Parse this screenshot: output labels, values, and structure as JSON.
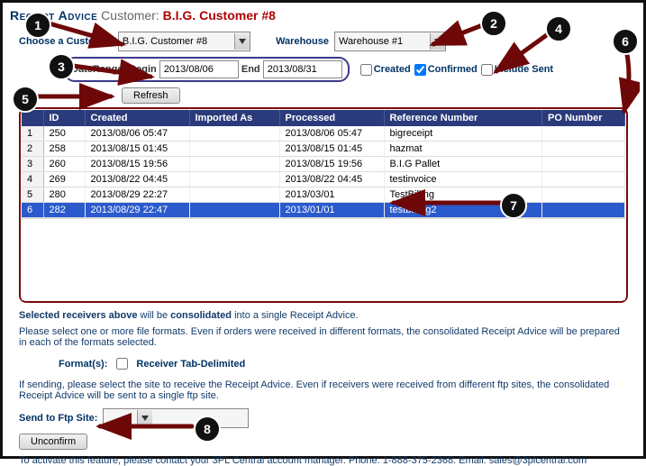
{
  "title": {
    "lead": "Receipt Advice",
    "custLabel": "Customer:",
    "name": "B.I.G. Customer #8"
  },
  "filters": {
    "chooseLabel": "Choose a Customer",
    "customer": "B.I.G. Customer #8",
    "warehouseLabel": "Warehouse",
    "warehouse": "Warehouse #1",
    "dateRangeLabel": "DateRange:",
    "beginLabel": "Begin",
    "begin": "2013/08/06",
    "endLabel": "End",
    "end": "2013/08/31",
    "createdLabel": "Created",
    "createdChecked": false,
    "confirmedLabel": "Confirmed",
    "confirmedChecked": true,
    "includeSentLabel": "Include Sent",
    "includeSentChecked": false,
    "refresh": "Refresh"
  },
  "columns": [
    "",
    "ID",
    "Created",
    "Imported As",
    "Processed",
    "Reference Number",
    "PO Number"
  ],
  "rows": [
    {
      "n": "1",
      "id": "250",
      "created": "2013/08/06 05:47",
      "imported": "",
      "processed": "2013/08/06 05:47",
      "ref": "bigreceipt",
      "po": ""
    },
    {
      "n": "2",
      "id": "258",
      "created": "2013/08/15 01:45",
      "imported": "",
      "processed": "2013/08/15 01:45",
      "ref": "hazmat",
      "po": ""
    },
    {
      "n": "3",
      "id": "260",
      "created": "2013/08/15 19:56",
      "imported": "",
      "processed": "2013/08/15 19:56",
      "ref": "B.I.G Pallet",
      "po": ""
    },
    {
      "n": "4",
      "id": "269",
      "created": "2013/08/22 04:45",
      "imported": "",
      "processed": "2013/08/22 04:45",
      "ref": "testinvoice",
      "po": ""
    },
    {
      "n": "5",
      "id": "280",
      "created": "2013/08/29 22:27",
      "imported": "",
      "processed": "2013/03/01",
      "ref": "TestBilling",
      "po": ""
    },
    {
      "n": "6",
      "id": "282",
      "created": "2013/08/29 22:47",
      "imported": "",
      "processed": "2013/01/01",
      "ref": "testbilling2",
      "po": "",
      "selected": true
    }
  ],
  "info": {
    "line1a": "Selected receivers above",
    "line1b": " will be ",
    "line1c": "consolidated",
    "line1d": " into a single Receipt Advice.",
    "line2": "Please select one or more file formats. Even if orders were received in different formats, the consolidated Receipt Advice will be prepared in each of the formats selected.",
    "formatsLabel": "Format(s):",
    "receiverTab": "Receiver Tab-Delimited",
    "line3": "If sending, please select the site to receive the Receipt Advice. Even if receivers were received from different ftp sites, the consolidated Receipt Advice will be sent to a single ftp site.",
    "sendFtpLabel": "Send to Ftp Site:",
    "unconfirm": "Unconfirm",
    "activate": "To activate this feature, please contact your 3PL Central account manager. Phone: 1-888-375-2368. Email: sales@3plcentral.com"
  },
  "annotations": [
    "1",
    "2",
    "3",
    "4",
    "5",
    "6",
    "7",
    "8"
  ]
}
